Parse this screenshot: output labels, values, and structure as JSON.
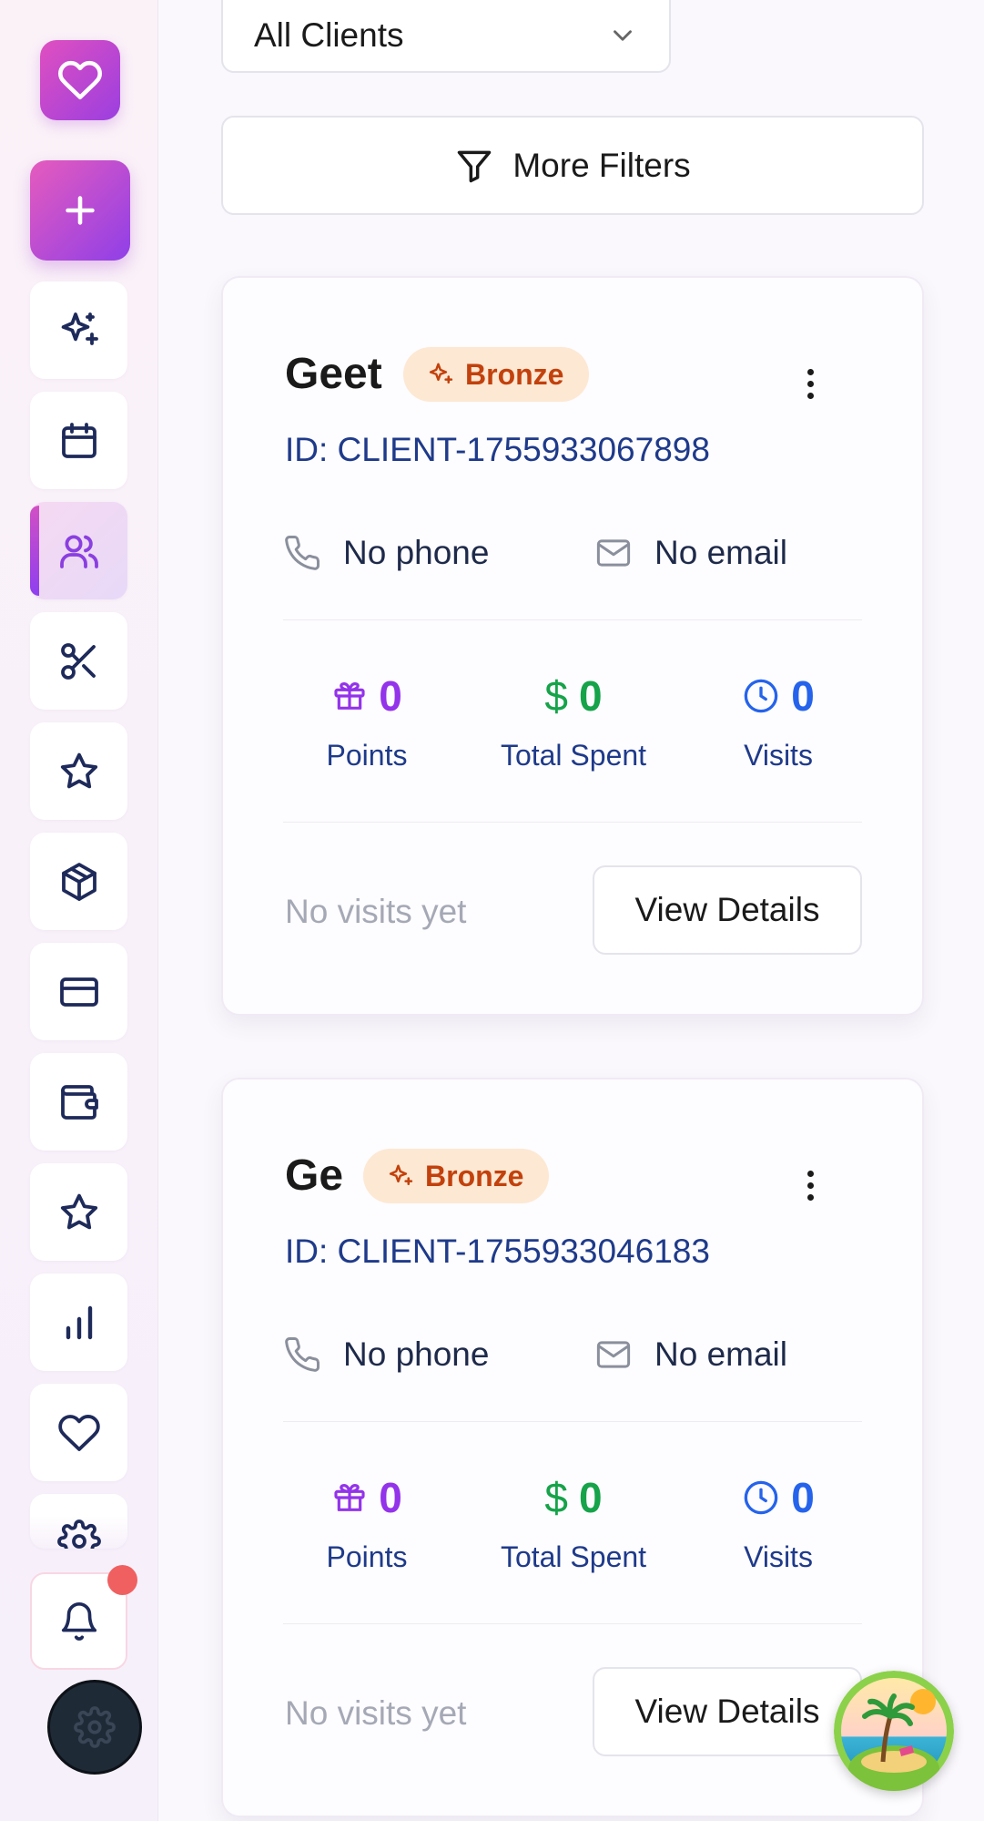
{
  "filter": {
    "client_select_value": "All Clients",
    "more_filters_label": "More Filters"
  },
  "clients": [
    {
      "name": "Geet",
      "tier": "Bronze",
      "id_text": "ID: CLIENT-1755933067898",
      "phone": "No phone",
      "email": "No email",
      "points_value": "0",
      "points_label": "Points",
      "spent_value": "0",
      "spent_label": "Total Spent",
      "visits_value": "0",
      "visits_label": "Visits",
      "last_visit": "No visits yet",
      "details_label": "View Details"
    },
    {
      "name": "Ge",
      "tier": "Bronze",
      "id_text": "ID: CLIENT-1755933046183",
      "phone": "No phone",
      "email": "No email",
      "points_value": "0",
      "points_label": "Points",
      "spent_value": "0",
      "spent_label": "Total Spent",
      "visits_value": "0",
      "visits_label": "Visits",
      "last_visit": "No visits yet",
      "details_label": "View Details"
    }
  ],
  "colors": {
    "brand_gradient_start": "#e04fc0",
    "brand_gradient_end": "#9b3fe0",
    "points": "#9333ea",
    "spent": "#16a34a",
    "visits": "#2563eb",
    "tier_bronze_text": "#c2410c",
    "tier_bronze_bg": "#fde8d3",
    "notification_dot": "#f06060"
  },
  "icons": {
    "sidebar": [
      "sparkles-icon",
      "calendar-icon",
      "users-icon",
      "scissors-icon",
      "star-icon",
      "package-icon",
      "credit-card-icon",
      "wallet-icon",
      "star-icon",
      "bar-chart-icon",
      "heart-icon",
      "gear-icon"
    ],
    "stats": [
      "gift-icon",
      "dollar-icon",
      "clock-icon"
    ]
  }
}
